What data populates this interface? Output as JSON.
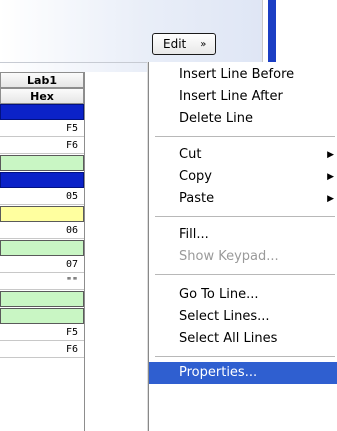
{
  "toolbar": {
    "edit_label": "Edit",
    "edit_chevron": "»"
  },
  "grid": {
    "header_title": "Lab1",
    "header_sub": "Hex",
    "rows": [
      {
        "text": "",
        "kind": "blue"
      },
      {
        "text": "F5",
        "kind": "plain"
      },
      {
        "text": "F6",
        "kind": "plain"
      },
      {
        "text": "",
        "kind": "green"
      },
      {
        "text": "",
        "kind": "blue"
      },
      {
        "text": "05",
        "kind": "plain"
      },
      {
        "text": "",
        "kind": "yellow"
      },
      {
        "text": "06",
        "kind": "plain"
      },
      {
        "text": "",
        "kind": "green"
      },
      {
        "text": "07",
        "kind": "plain"
      },
      {
        "text": "\"\"",
        "kind": "plain"
      },
      {
        "text": "",
        "kind": "green"
      },
      {
        "text": "",
        "kind": "green"
      },
      {
        "text": "F5",
        "kind": "plain"
      },
      {
        "text": "F6",
        "kind": "plain"
      }
    ]
  },
  "menu": {
    "insert_before": "Insert Line Before",
    "insert_after": "Insert Line After",
    "delete_line": "Delete Line",
    "cut": "Cut",
    "copy": "Copy",
    "paste": "Paste",
    "fill": "Fill...",
    "show_keypad": "Show Keypad...",
    "go_to_line": "Go To Line...",
    "select_lines": "Select Lines...",
    "select_all_lines": "Select All Lines",
    "properties": "Properties...",
    "submenu_arrow": "▶"
  },
  "colors": {
    "selection": "#2f5fd0",
    "row_blue": "#0b22c8",
    "row_green": "#c9f6c4",
    "row_yellow": "#ffff9f"
  }
}
